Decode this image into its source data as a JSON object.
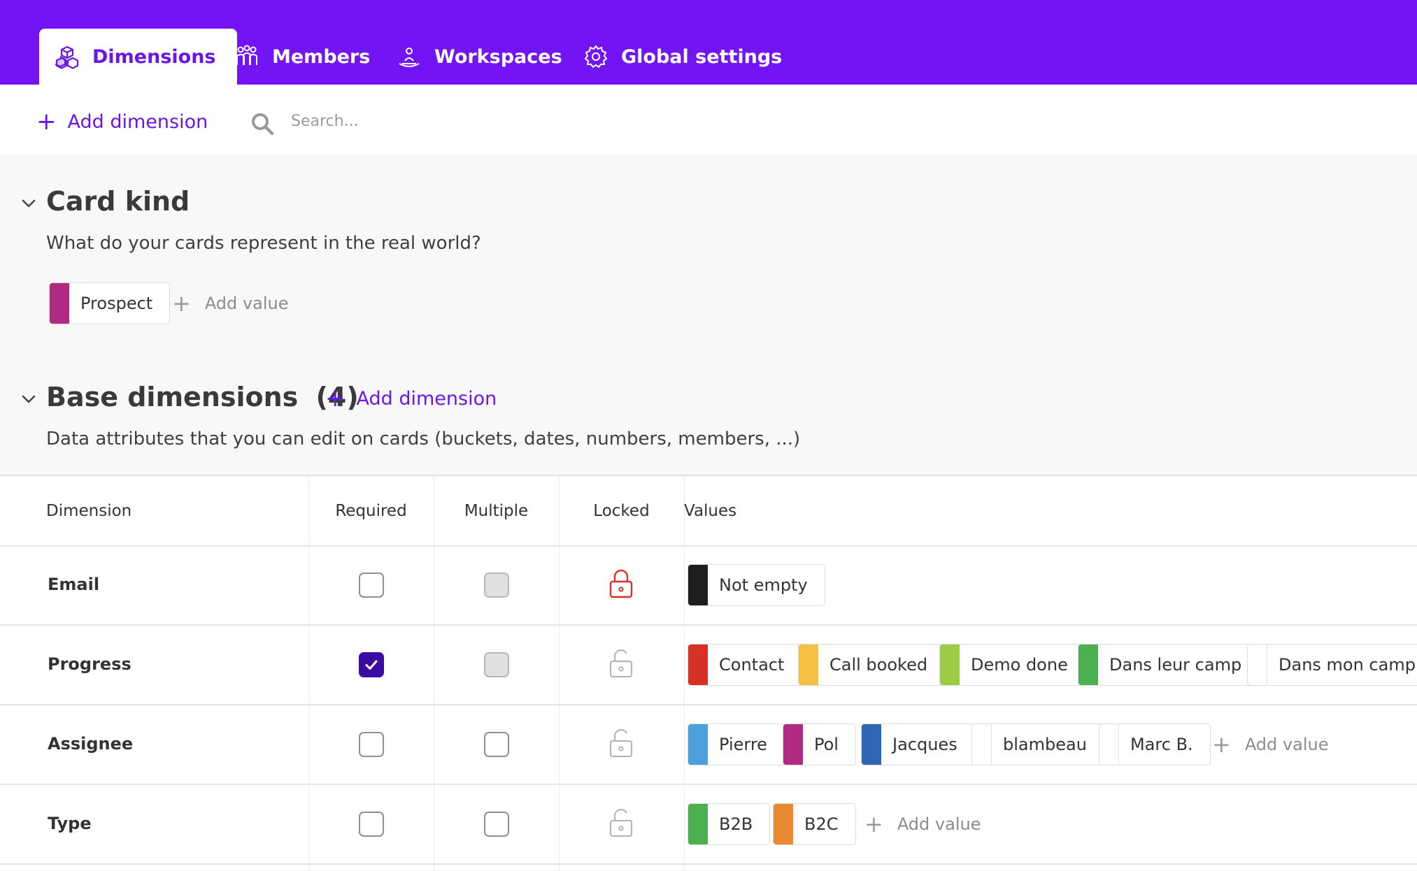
{
  "tabs": [
    {
      "label": "Dimensions",
      "icon": "cubes-icon",
      "active": true
    },
    {
      "label": "Members",
      "icon": "members-icon",
      "active": false
    },
    {
      "label": "Workspaces",
      "icon": "workspaces-icon",
      "active": false
    },
    {
      "label": "Global settings",
      "icon": "gear-icon",
      "active": false
    }
  ],
  "toolbar": {
    "add_dimension_label": "Add dimension",
    "search_placeholder": "Search..."
  },
  "card_kind": {
    "title": "Card kind",
    "description": "What do your cards represent in the real world?",
    "values": [
      {
        "label": "Prospect",
        "color": "#b02a82"
      }
    ],
    "add_value_label": "Add value"
  },
  "base_dimensions": {
    "title": "Base dimensions",
    "count": "(4)",
    "add_dimension_label": "Add dimension",
    "description": "Data attributes that you can edit on cards (buckets, dates, numbers, members, ...)"
  },
  "table": {
    "headers": {
      "dimension": "Dimension",
      "required": "Required",
      "multiple": "Multiple",
      "locked": "Locked",
      "values": "Values"
    },
    "add_value_label": "Add value",
    "rows": [
      {
        "name": "Email",
        "required": false,
        "multiple": false,
        "multiple_disabled": true,
        "locked": true,
        "values": [
          {
            "label": "Not empty",
            "color": "#1e1e1e"
          }
        ]
      },
      {
        "name": "Progress",
        "required": true,
        "multiple": false,
        "multiple_disabled": true,
        "locked": false,
        "values": [
          {
            "label": "Contact",
            "color": "#d93025"
          },
          {
            "label": "Call booked",
            "color": "#f4bf42"
          },
          {
            "label": "Demo done",
            "color": "#9ccc45"
          },
          {
            "label": "Dans leur camp",
            "color": "#4caf50"
          },
          {
            "label": "Dans mon camp",
            "color": null
          }
        ]
      },
      {
        "name": "Assignee",
        "required": false,
        "multiple": false,
        "multiple_disabled": false,
        "locked": false,
        "values": [
          {
            "label": "Pierre",
            "color": "#4a9fdc"
          },
          {
            "label": "Pol",
            "color": "#b02a82"
          },
          {
            "label": "Jacques",
            "color": "#2f66b8"
          },
          {
            "label": "blambeau",
            "color": null
          },
          {
            "label": "Marc B.",
            "color": null
          }
        ]
      },
      {
        "name": "Type",
        "required": false,
        "multiple": false,
        "multiple_disabled": false,
        "locked": false,
        "values": [
          {
            "label": "B2B",
            "color": "#4caf50"
          },
          {
            "label": "B2C",
            "color": "#ea8a30"
          }
        ]
      }
    ]
  },
  "colors": {
    "brand": "#7214f4",
    "accent": "#6b16e6",
    "locked": "#d93025",
    "checked": "#3a0ca3"
  }
}
